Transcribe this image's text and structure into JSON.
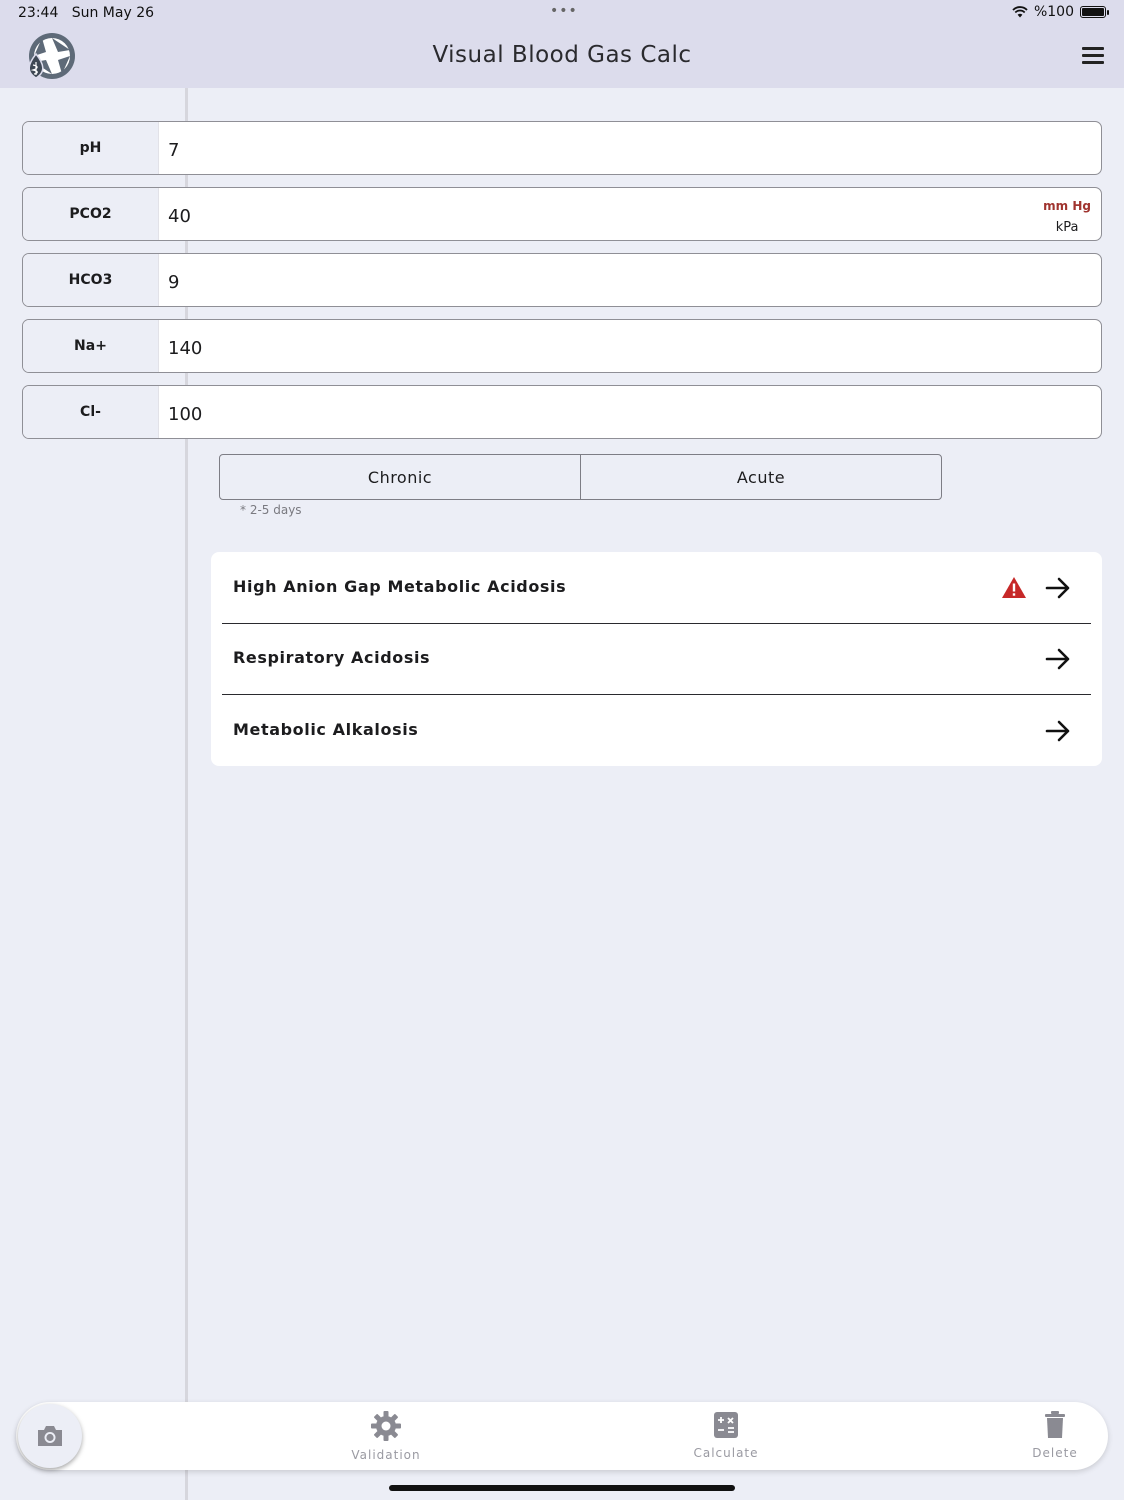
{
  "status_bar": {
    "time": "23:44",
    "date": "Sun May 26",
    "dots": "•••",
    "battery_text": "%100"
  },
  "header": {
    "title": "Visual Blood Gas Calc",
    "logo_icon": "aperture-caduceus-logo",
    "menu_icon": "hamburger-menu-icon"
  },
  "fields": [
    {
      "label": "pH",
      "value": "7"
    },
    {
      "label": "PCO2",
      "value": "40",
      "units": [
        "mm Hg",
        "kPa"
      ],
      "selected_unit": "mm Hg"
    },
    {
      "label": "HCO3",
      "value": "9"
    },
    {
      "label": "Na+",
      "value": "140"
    },
    {
      "label": "Cl-",
      "value": "100"
    }
  ],
  "chronicity": {
    "options": [
      "Chronic",
      "Acute"
    ],
    "note": "* 2-5 days"
  },
  "results": [
    {
      "label": "High Anion Gap Metabolic Acidosis",
      "warning": true
    },
    {
      "label": "Respiratory Acidosis",
      "warning": false
    },
    {
      "label": "Metabolic Alkalosis",
      "warning": false
    }
  ],
  "colors": {
    "accent_red": "#a0342f",
    "warning_red": "#c62828",
    "background": "#eceef6",
    "header": "#dcdcec"
  },
  "tabbar": {
    "validation": "Validation",
    "calculate": "Calculate",
    "delete": "Delete"
  }
}
